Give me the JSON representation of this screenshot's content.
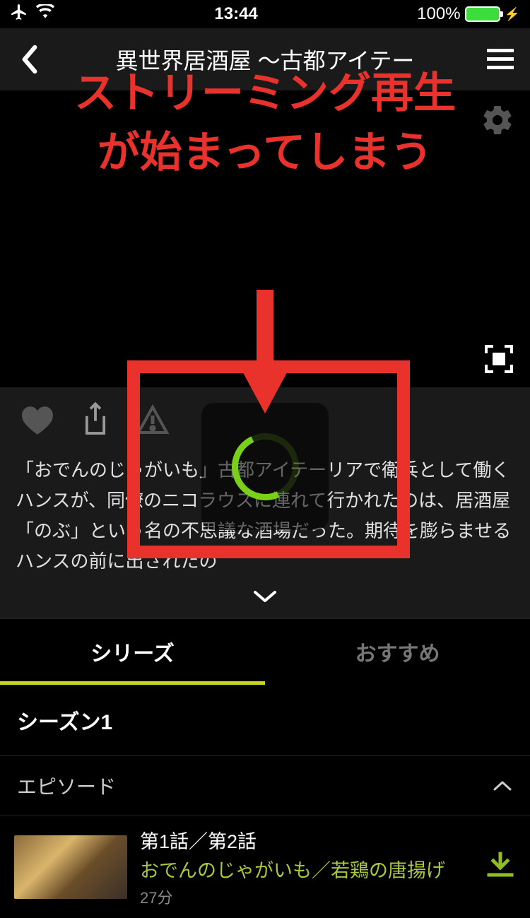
{
  "status_bar": {
    "time": "13:44",
    "battery_percent": "100%"
  },
  "nav": {
    "title": "異世界居酒屋 〜古都アイテー"
  },
  "annotation": {
    "line1": "ストリーミング再生",
    "line2": "が始まってしまう"
  },
  "description": "「おでんのじゃがいも」古都アイテーリアで衛兵として働くハンスが、同僚のニコラウスに連れて行かれたのは、居酒屋「のぶ」という名の不思議な酒場だった。期待を膨らませるハンスの前に出されたの",
  "tabs": {
    "series": "シリーズ",
    "recommend": "おすすめ"
  },
  "season_label": "シーズン1",
  "episodes_label": "エピソード",
  "episodes": [
    {
      "title": "第1話／第2話",
      "subtitle": "おでんのじゃがいも／若鶏の唐揚げ",
      "duration": "27分"
    }
  ],
  "colors": {
    "accent": "#a9c93a",
    "annotation": "#e8322b"
  }
}
